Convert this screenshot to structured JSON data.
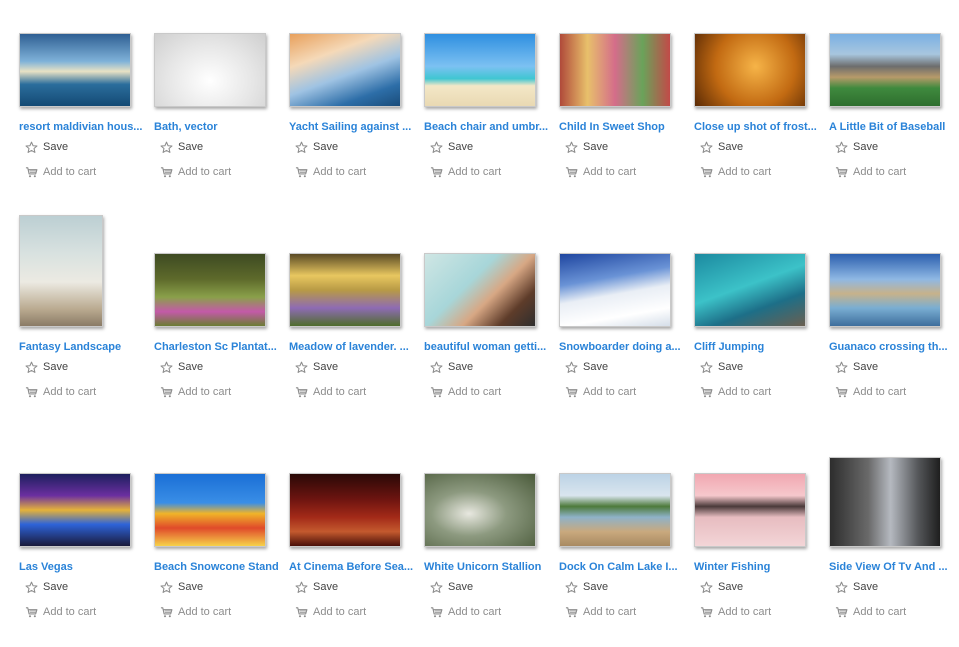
{
  "actions": {
    "save_label": "Save",
    "cart_label": "Add to cart"
  },
  "items": [
    {
      "title": "resort maldivian hous...",
      "bg": "linear-gradient(180deg,#2f5f93 0%,#7fb2d9 38%,#e8e2c4 52%,#2a6d9c 70%,#144a74 100%)",
      "aspect": "landscape"
    },
    {
      "title": "Bath, vector",
      "bg": "radial-gradient(ellipse at 50% 65%,#ffffff 0%,#e6e6e6 55%,#cfcfcf 100%)",
      "aspect": "landscape"
    },
    {
      "title": "Yacht Sailing against ...",
      "bg": "linear-gradient(160deg,#e8a05c 0%,#f5d9b8 30%,#9fc3e3 55%,#2d6ea8 80%,#1a4c7a 100%)",
      "aspect": "landscape"
    },
    {
      "title": "Beach chair and umbr...",
      "bg": "linear-gradient(180deg,#2f8fe0 0%,#7cc1f2 45%,#40c6d2 62%,#f3e7c7 72%,#e9d9b3 100%)",
      "aspect": "landscape"
    },
    {
      "title": "Child In Sweet Shop",
      "bg": "linear-gradient(90deg,#b04a3a 0%,#e8c06b 25%,#d46d8a 50%,#6aa35a 75%,#c24a48 100%)",
      "aspect": "landscape"
    },
    {
      "title": "Close up shot of frost...",
      "bg": "radial-gradient(circle at 55% 45%,#f6b448 0%,#c26a12 55%,#5a2a05 100%)",
      "aspect": "landscape"
    },
    {
      "title": "A Little Bit of Baseball",
      "bg": "linear-gradient(180deg,#7ab0e3 0%,#a8c6df 28%,#6d6d6d 45%,#b79a6a 60%,#3f8a3e 75%,#2e6e2e 100%)",
      "aspect": "landscape"
    },
    {
      "title": "Fantasy Landscape",
      "bg": "linear-gradient(180deg,#bccfd3 0%,#d9e2e0 35%,#eceae2 60%,#b9a98f 85%,#8a7b66 100%)",
      "aspect": "portrait"
    },
    {
      "title": "Charleston Sc Plantat...",
      "bg": "linear-gradient(180deg,#3d4a22 0%,#5e6a2b 35%,#8aa04a 60%,#c35aa8 80%,#6b7d34 100%)",
      "aspect": "landscape"
    },
    {
      "title": "Meadow of lavender. ...",
      "bg": "linear-gradient(180deg,#5a4a25 0%,#e8c760 30%,#b89a45 50%,#8e6bb4 75%,#4f6d2c 100%)",
      "aspect": "landscape"
    },
    {
      "title": "beautiful woman getti...",
      "bg": "linear-gradient(135deg,#cfe6e4 0%,#a7d6d9 40%,#d7a784 60%,#5e3c2a 80%,#2e2e2e 100%)",
      "aspect": "landscape"
    },
    {
      "title": "Snowboarder doing a...",
      "bg": "linear-gradient(170deg,#1f46a0 0%,#6a93d6 35%,#e9eef5 55%,#ffffff 80%,#d5dee9 100%)",
      "aspect": "landscape"
    },
    {
      "title": "Cliff Jumping",
      "bg": "linear-gradient(160deg,#1c8aa0 0%,#3cc2c8 45%,#1d6f88 70%,#6b5f50 100%)",
      "aspect": "landscape"
    },
    {
      "title": "Guanaco crossing th...",
      "bg": "linear-gradient(180deg,#2b5fae 0%,#8fb8e4 35%,#c7b28a 55%,#7aaed2 75%,#3e6e9c 100%)",
      "aspect": "landscape"
    },
    {
      "title": "Las Vegas",
      "bg": "linear-gradient(180deg,#1d1f5e 0%,#6b2fa0 30%,#e5b23a 50%,#2e63d8 70%,#1a1a3a 100%)",
      "aspect": "landscape"
    },
    {
      "title": "Beach Snowcone Stand",
      "bg": "linear-gradient(180deg,#1a6fd6 0%,#3a8ee6 40%,#f0b429 55%,#e04a2a 75%,#f6d24a 100%)",
      "aspect": "landscape"
    },
    {
      "title": "At Cinema Before Sea...",
      "bg": "linear-gradient(180deg,#2a0906 0%,#6d1410 35%,#a32a18 60%,#c45a2e 80%,#4a0f08 100%)",
      "aspect": "landscape"
    },
    {
      "title": "White Unicorn Stallion",
      "bg": "radial-gradient(ellipse at 40% 55%,#e8e8e0 0%,#8d9a80 40%,#4a5a3a 100%)",
      "aspect": "landscape"
    },
    {
      "title": "Dock On Calm Lake I...",
      "bg": "linear-gradient(180deg,#bcd3e6 0%,#d9e5ee 30%,#4d7a3a 45%,#8fb2c8 60%,#c9a97e 80%,#a88a62 100%)",
      "aspect": "landscape"
    },
    {
      "title": "Winter Fishing",
      "bg": "linear-gradient(180deg,#f1a7b1 0%,#f6c8cc 30%,#4a3a3a 45%,#e7bcc0 60%,#f3d5d7 100%)",
      "aspect": "landscape"
    },
    {
      "title": "Side View Of Tv And ...",
      "bg": "linear-gradient(90deg,#2d2d2d 0%,#6a6a6a 35%,#b5b9c0 55%,#55575a 80%,#1e1e1e 100%)",
      "aspect": "portrait-wide"
    }
  ]
}
